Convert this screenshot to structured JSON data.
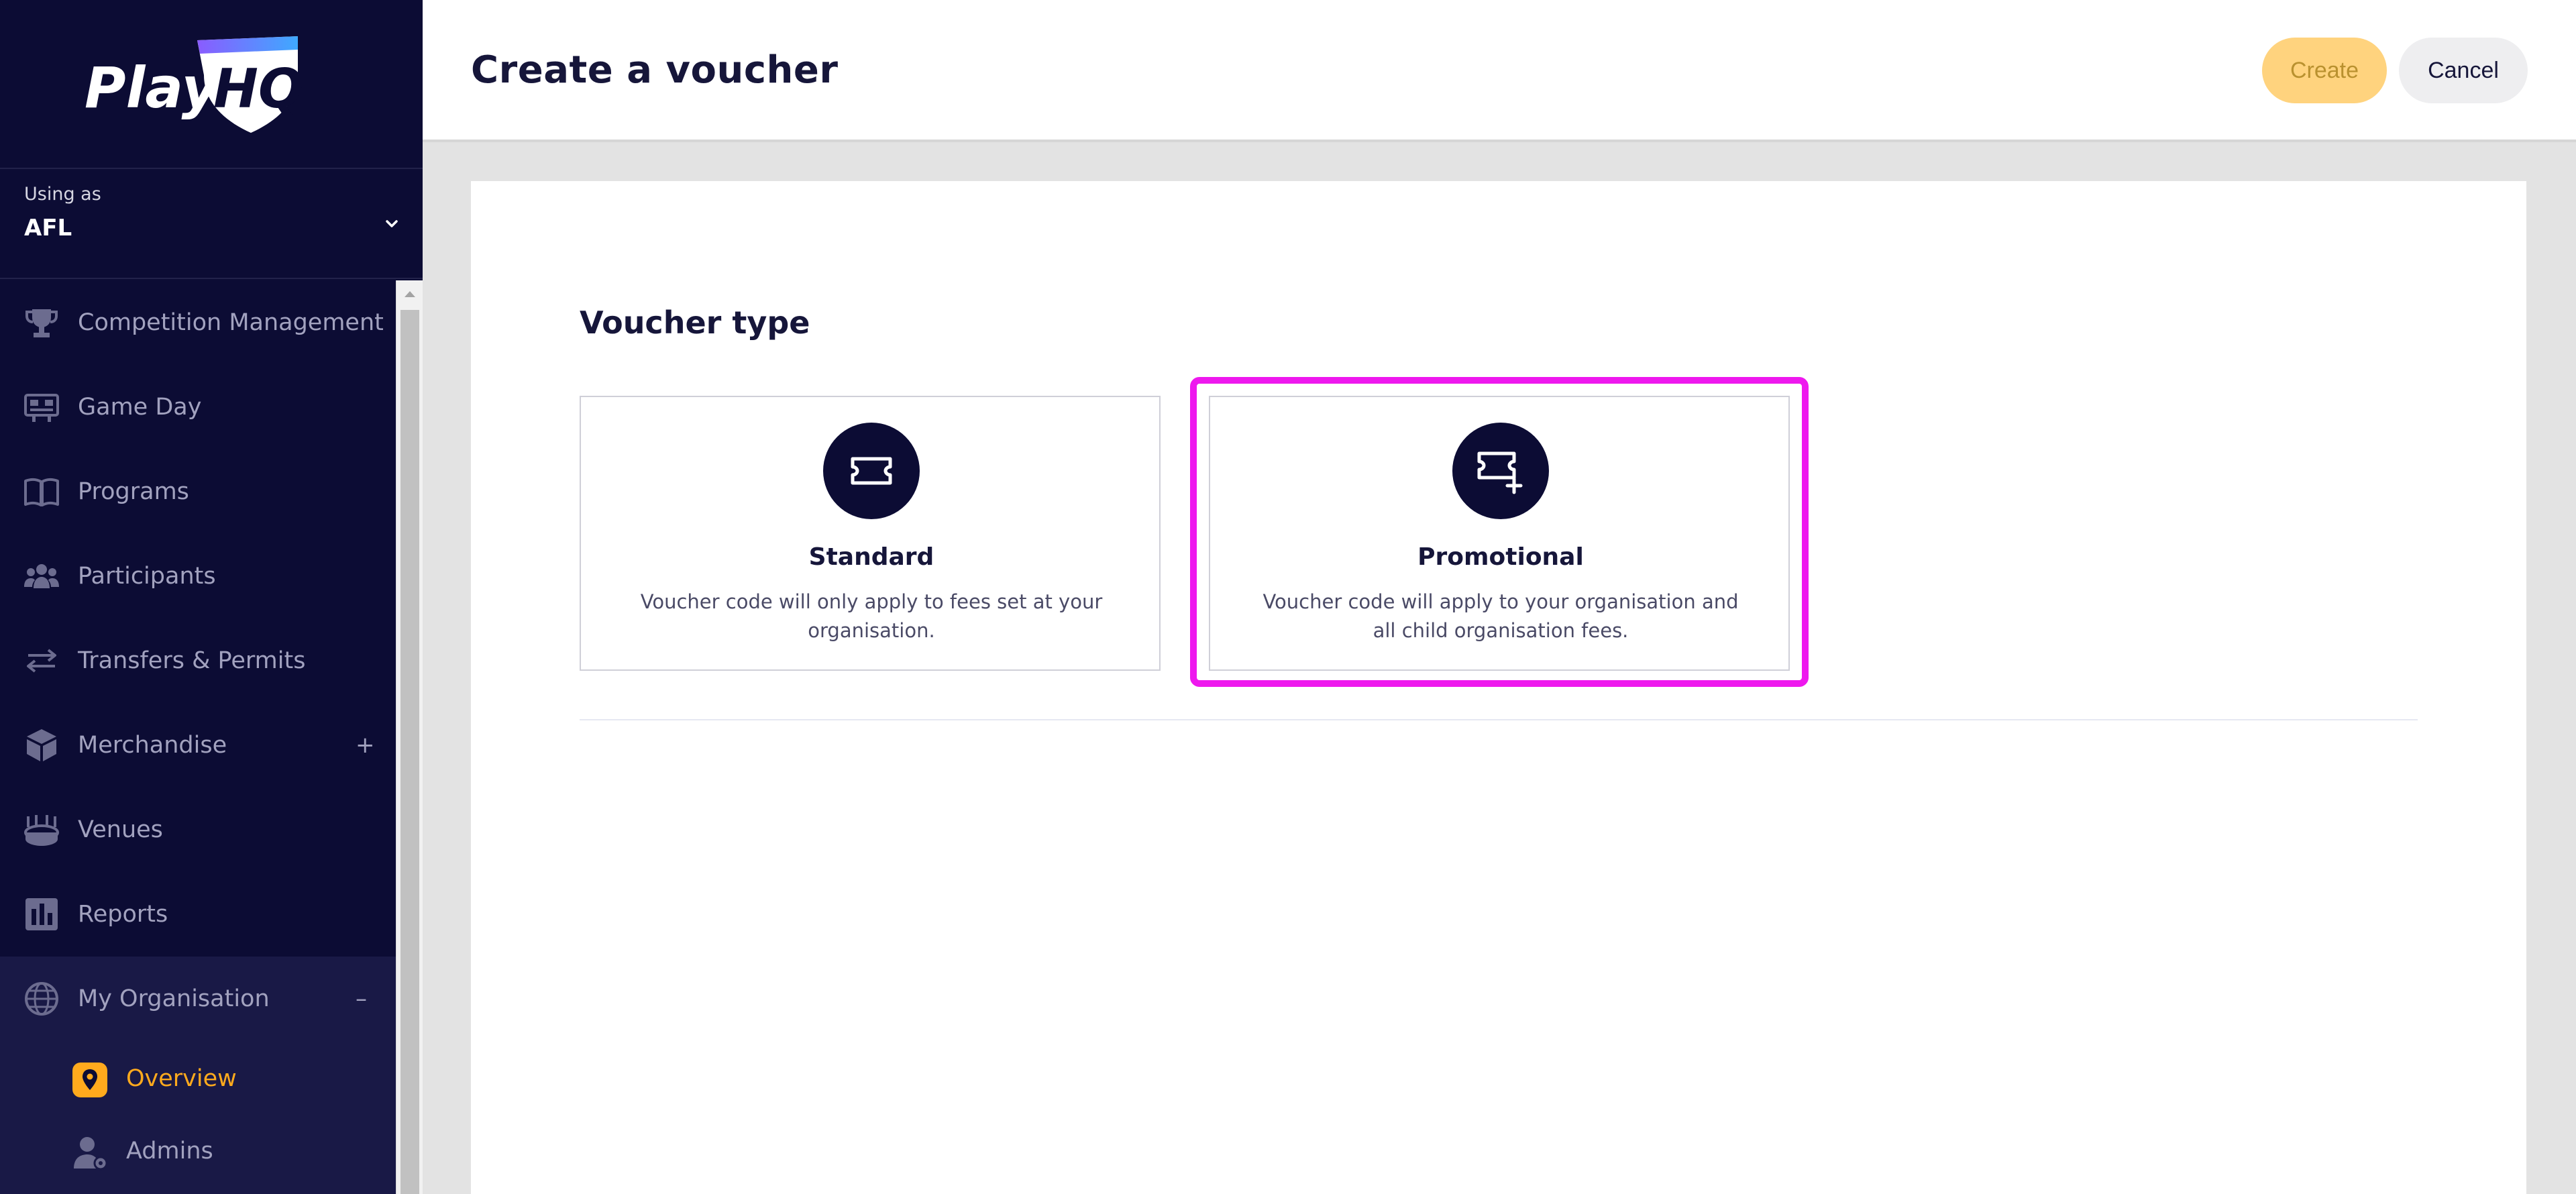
{
  "brand": {
    "logo_text": "PlayHQ",
    "accent": "#ffaa1d",
    "navy": "#0c0c34",
    "highlight": "#ee18ee"
  },
  "org_switcher": {
    "caption": "Using as",
    "org": "AFL",
    "icon": "chevron-down-icon"
  },
  "nav": {
    "items": [
      {
        "label": "Competition Management",
        "icon": "trophy-icon"
      },
      {
        "label": "Game Day",
        "icon": "scoreboard-icon"
      },
      {
        "label": "Programs",
        "icon": "book-icon"
      },
      {
        "label": "Participants",
        "icon": "people-icon"
      },
      {
        "label": "Transfers & Permits",
        "icon": "transfer-arrows-icon"
      },
      {
        "label": "Merchandise",
        "icon": "box-icon",
        "expander": "+"
      },
      {
        "label": "Venues",
        "icon": "stadium-icon"
      },
      {
        "label": "Reports",
        "icon": "bar-chart-icon"
      },
      {
        "label": "My Organisation",
        "icon": "globe-icon",
        "expander": "–"
      }
    ],
    "sub_items": [
      {
        "label": "Overview",
        "icon": "location-pin-icon",
        "current": true
      },
      {
        "label": "Admins",
        "icon": "admin-user-icon"
      }
    ]
  },
  "header": {
    "title": "Create a voucher",
    "create_label": "Create",
    "cancel_label": "Cancel"
  },
  "voucher": {
    "section_title": "Voucher type",
    "options": [
      {
        "title": "Standard",
        "description": "Voucher code will only apply to fees set at your organisation.",
        "icon": "ticket-icon"
      },
      {
        "title": "Promotional",
        "description": "Voucher code will apply to your organisation and all child organisation fees.",
        "icon": "ticket-plus-icon",
        "highlighted": true
      }
    ]
  }
}
